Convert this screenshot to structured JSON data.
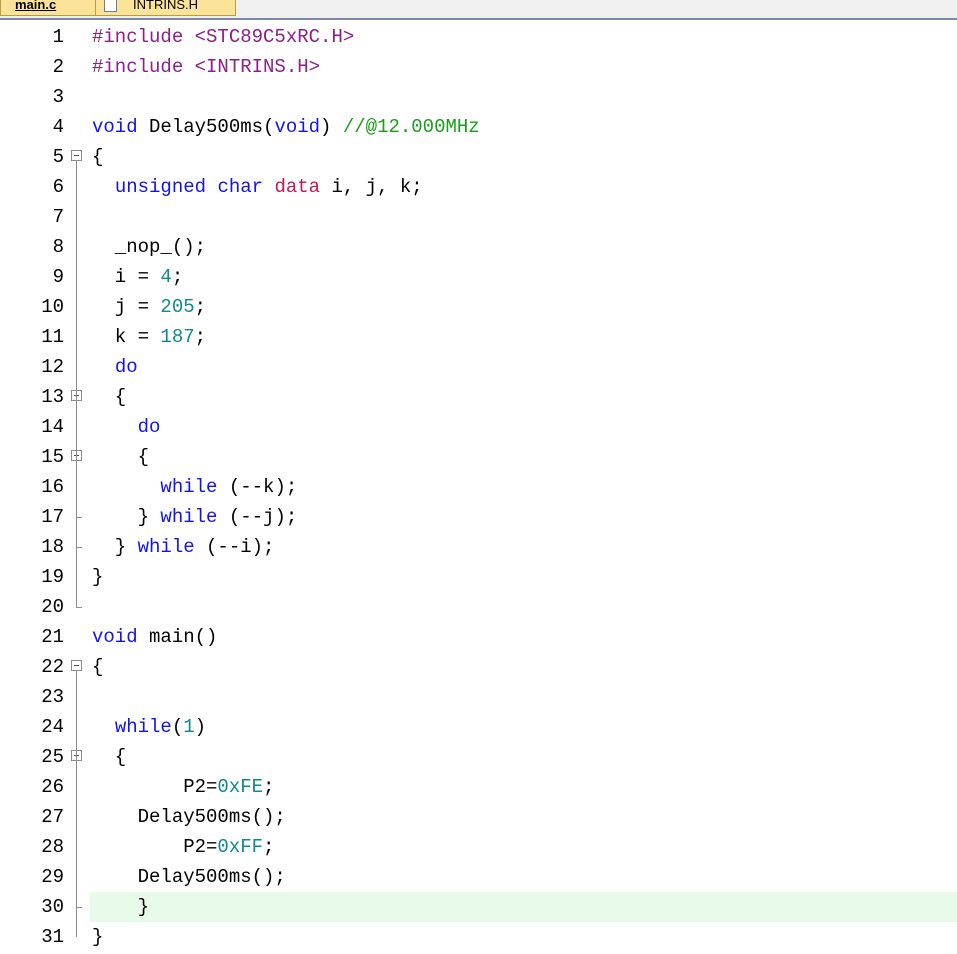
{
  "tabs": [
    {
      "label": "main.c",
      "active": true
    },
    {
      "label": "INTRINS.H",
      "active": false
    }
  ],
  "colors": {
    "preprocessor": "#8b1f8b",
    "keyword": "#1414e6",
    "type": "#c4165a",
    "number": "#0e8a8a",
    "comment": "#1a9e1a",
    "current_line_bg": "#e8fbe8",
    "tab_bg": "#fbe39a"
  },
  "editor": {
    "current_line": 30,
    "lines": [
      {
        "n": "1",
        "fold": false,
        "tokens": [
          {
            "t": "pp",
            "v": "#include <STC89C5xRC.H>"
          }
        ]
      },
      {
        "n": "2",
        "fold": false,
        "tokens": [
          {
            "t": "pp",
            "v": "#include <INTRINS.H>"
          }
        ]
      },
      {
        "n": "3",
        "fold": false,
        "tokens": []
      },
      {
        "n": "4",
        "fold": false,
        "tokens": [
          {
            "t": "kw",
            "v": "void"
          },
          {
            "t": "pl",
            "v": " Delay500ms("
          },
          {
            "t": "kw",
            "v": "void"
          },
          {
            "t": "pl",
            "v": ") "
          },
          {
            "t": "cm",
            "v": "//@12.000MHz"
          }
        ]
      },
      {
        "n": "5",
        "fold": true,
        "tokens": [
          {
            "t": "pl",
            "v": "{"
          }
        ]
      },
      {
        "n": "6",
        "fold": false,
        "tokens": [
          {
            "t": "pl",
            "v": "  "
          },
          {
            "t": "kw",
            "v": "unsigned"
          },
          {
            "t": "pl",
            "v": " "
          },
          {
            "t": "kw",
            "v": "char"
          },
          {
            "t": "pl",
            "v": " "
          },
          {
            "t": "ty",
            "v": "data"
          },
          {
            "t": "pl",
            "v": " i, j, k;"
          }
        ]
      },
      {
        "n": "7",
        "fold": false,
        "tokens": []
      },
      {
        "n": "8",
        "fold": false,
        "tokens": [
          {
            "t": "pl",
            "v": "  _nop_();"
          }
        ]
      },
      {
        "n": "9",
        "fold": false,
        "tokens": [
          {
            "t": "pl",
            "v": "  i = "
          },
          {
            "t": "num",
            "v": "4"
          },
          {
            "t": "pl",
            "v": ";"
          }
        ]
      },
      {
        "n": "10",
        "fold": false,
        "tokens": [
          {
            "t": "pl",
            "v": "  j = "
          },
          {
            "t": "num",
            "v": "205"
          },
          {
            "t": "pl",
            "v": ";"
          }
        ]
      },
      {
        "n": "11",
        "fold": false,
        "tokens": [
          {
            "t": "pl",
            "v": "  k = "
          },
          {
            "t": "num",
            "v": "187"
          },
          {
            "t": "pl",
            "v": ";"
          }
        ]
      },
      {
        "n": "12",
        "fold": false,
        "tokens": [
          {
            "t": "pl",
            "v": "  "
          },
          {
            "t": "kw",
            "v": "do"
          }
        ]
      },
      {
        "n": "13",
        "fold": true,
        "tokens": [
          {
            "t": "pl",
            "v": "  {"
          }
        ]
      },
      {
        "n": "14",
        "fold": false,
        "tokens": [
          {
            "t": "pl",
            "v": "    "
          },
          {
            "t": "kw",
            "v": "do"
          }
        ]
      },
      {
        "n": "15",
        "fold": true,
        "tokens": [
          {
            "t": "pl",
            "v": "    {"
          }
        ]
      },
      {
        "n": "16",
        "fold": false,
        "tokens": [
          {
            "t": "pl",
            "v": "      "
          },
          {
            "t": "kw",
            "v": "while"
          },
          {
            "t": "pl",
            "v": " (--k);"
          }
        ]
      },
      {
        "n": "17",
        "fold": false,
        "tokens": [
          {
            "t": "pl",
            "v": "    } "
          },
          {
            "t": "kw",
            "v": "while"
          },
          {
            "t": "pl",
            "v": " (--j);"
          }
        ]
      },
      {
        "n": "18",
        "fold": false,
        "tokens": [
          {
            "t": "pl",
            "v": "  } "
          },
          {
            "t": "kw",
            "v": "while"
          },
          {
            "t": "pl",
            "v": " (--i);"
          }
        ]
      },
      {
        "n": "19",
        "fold": false,
        "tokens": [
          {
            "t": "pl",
            "v": "}"
          }
        ]
      },
      {
        "n": "20",
        "fold": false,
        "tokens": []
      },
      {
        "n": "21",
        "fold": false,
        "tokens": [
          {
            "t": "kw",
            "v": "void"
          },
          {
            "t": "pl",
            "v": " main()"
          }
        ]
      },
      {
        "n": "22",
        "fold": true,
        "tokens": [
          {
            "t": "pl",
            "v": "{"
          }
        ]
      },
      {
        "n": "23",
        "fold": false,
        "tokens": []
      },
      {
        "n": "24",
        "fold": false,
        "tokens": [
          {
            "t": "pl",
            "v": "  "
          },
          {
            "t": "kw",
            "v": "while"
          },
          {
            "t": "pl",
            "v": "("
          },
          {
            "t": "num",
            "v": "1"
          },
          {
            "t": "pl",
            "v": ")"
          }
        ]
      },
      {
        "n": "25",
        "fold": true,
        "tokens": [
          {
            "t": "pl",
            "v": "  {"
          }
        ]
      },
      {
        "n": "26",
        "fold": false,
        "tokens": [
          {
            "t": "pl",
            "v": "        P2="
          },
          {
            "t": "num",
            "v": "0xFE"
          },
          {
            "t": "pl",
            "v": ";"
          }
        ]
      },
      {
        "n": "27",
        "fold": false,
        "tokens": [
          {
            "t": "pl",
            "v": "    Delay500ms();"
          }
        ]
      },
      {
        "n": "28",
        "fold": false,
        "tokens": [
          {
            "t": "pl",
            "v": "        P2="
          },
          {
            "t": "num",
            "v": "0xFF"
          },
          {
            "t": "pl",
            "v": ";"
          }
        ]
      },
      {
        "n": "29",
        "fold": false,
        "tokens": [
          {
            "t": "pl",
            "v": "    Delay500ms();"
          }
        ]
      },
      {
        "n": "30",
        "fold": false,
        "tokens": [
          {
            "t": "pl",
            "v": "    }"
          }
        ]
      },
      {
        "n": "31",
        "fold": false,
        "tokens": [
          {
            "t": "pl",
            "v": "}"
          }
        ]
      }
    ]
  }
}
